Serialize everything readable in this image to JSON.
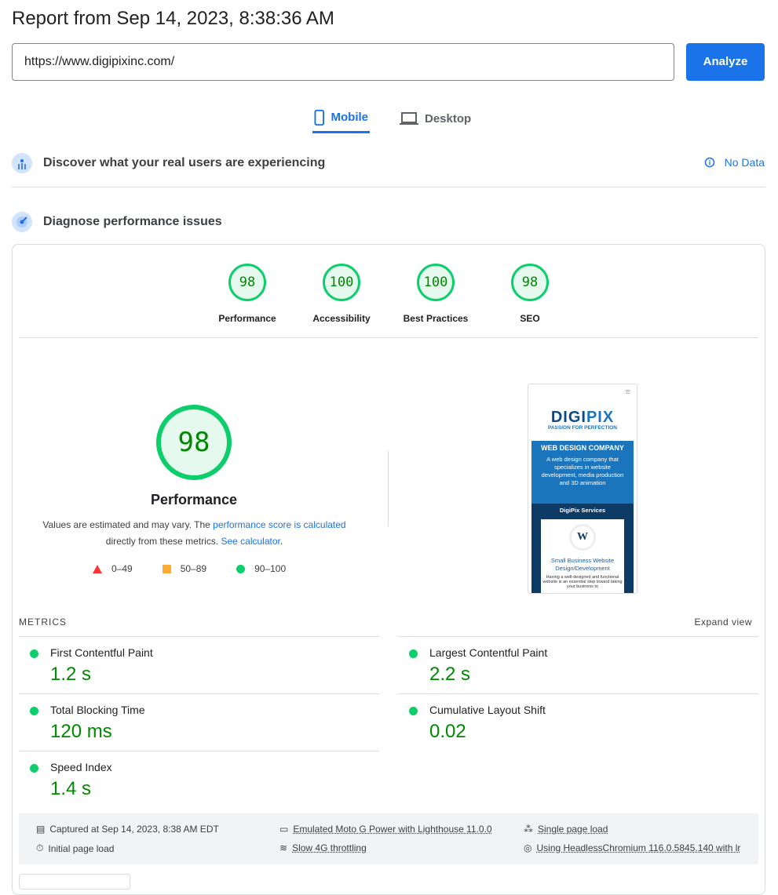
{
  "title": "Report from Sep 14, 2023, 8:38:36 AM",
  "url": "https://www.digipixinc.com/",
  "analyze": "Analyze",
  "tabs": [
    {
      "label": "Mobile",
      "active": true
    },
    {
      "label": "Desktop",
      "active": false
    }
  ],
  "discover": {
    "label": "Discover what your real users are experiencing",
    "status": "No Data"
  },
  "diagnose": {
    "label": "Diagnose performance issues"
  },
  "scores": [
    {
      "label": "Performance",
      "value": "98"
    },
    {
      "label": "Accessibility",
      "value": "100"
    },
    {
      "label": "Best Practices",
      "value": "100"
    },
    {
      "label": "SEO",
      "value": "98"
    }
  ],
  "performance": {
    "score": "98",
    "title": "Performance",
    "desc1": "Values are estimated and may vary. The ",
    "link1": "performance score is calculated",
    "desc2": " directly from these metrics. ",
    "link2": "See calculator",
    "desc3": "."
  },
  "legend": [
    {
      "range": "0–49",
      "color": "#ff3333"
    },
    {
      "range": "50–89",
      "color": "#ffaa33"
    },
    {
      "range": "90–100",
      "color": "#0cce6b"
    }
  ],
  "screenshot": {
    "logo": "DIGIPIX",
    "tagline": "PASSION FOR PERFECTION",
    "heading": "WEB DESIGN COMPANY",
    "sub": "A web design company that specializes in website development, media production and 3D animation",
    "services": "DigiPix Services",
    "card_title": "Small Business Website Design/Development",
    "card_text": "Having a well-designed and functional website is an essential step toward taking your business to"
  },
  "metrics": {
    "heading": "METRICS",
    "expand": "Expand view",
    "items": [
      {
        "name": "First Contentful Paint",
        "value": "1.2 s"
      },
      {
        "name": "Largest Contentful Paint",
        "value": "2.2 s"
      },
      {
        "name": "Total Blocking Time",
        "value": "120 ms"
      },
      {
        "name": "Cumulative Layout Shift",
        "value": "0.02"
      },
      {
        "name": "Speed Index",
        "value": "1.4 s"
      }
    ]
  },
  "footer": {
    "captured": "Captured at Sep 14, 2023, 8:38 AM EDT",
    "initial": "Initial page load",
    "device": "Emulated Moto G Power with Lighthouse 11.0.0",
    "throttle": "Slow 4G throttling",
    "single": "Single page load",
    "browser": "Using HeadlessChromium 116.0.5845.140 with lr"
  },
  "colors": {
    "accent": "#1a73e8",
    "pass": "#0cce6b",
    "pass_text": "#008800"
  }
}
